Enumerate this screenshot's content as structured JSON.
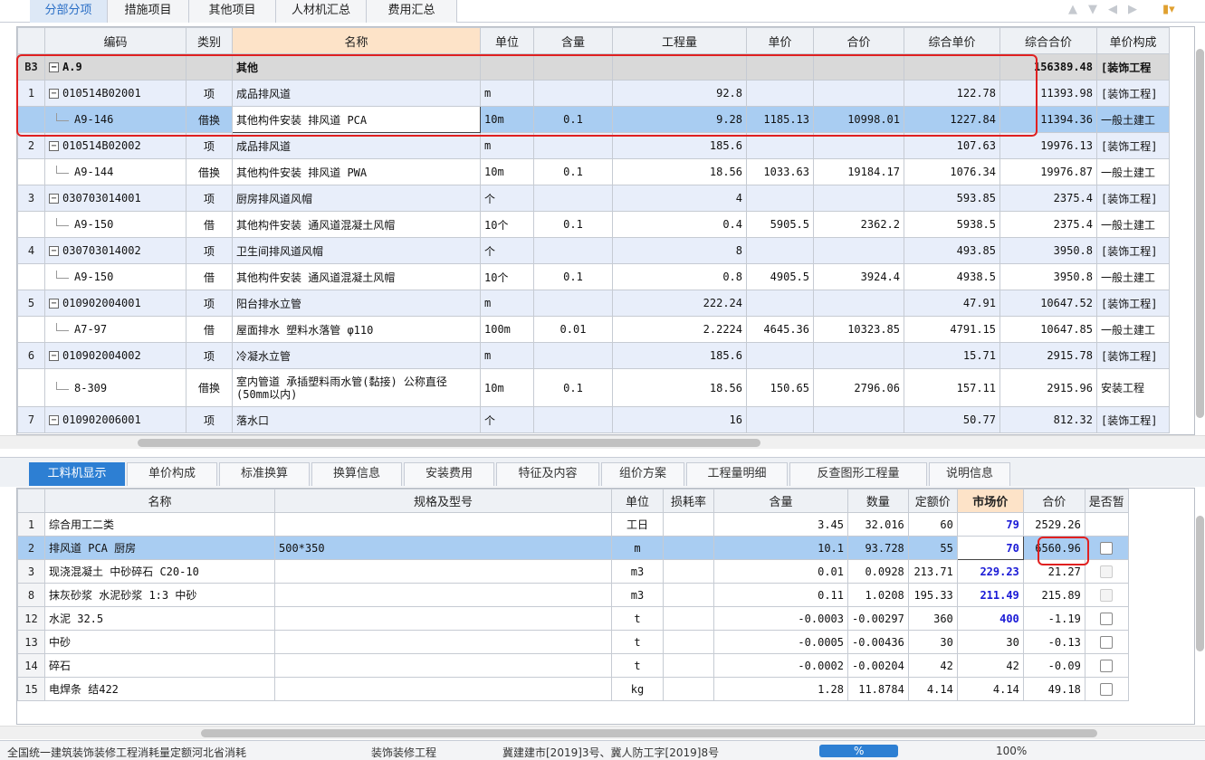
{
  "tabs": [
    "分部分项",
    "措施项目",
    "其他项目",
    "人材机汇总",
    "费用汇总"
  ],
  "top_headers": [
    "",
    "编码",
    "类别",
    "名称",
    "单位",
    "含量",
    "工程量",
    "单价",
    "合价",
    "综合单价",
    "综合合价",
    "单价构成"
  ],
  "top_rows": [
    {
      "kind": "sec",
      "rn": "B3",
      "code": "A.9",
      "cat": "",
      "name": "其他",
      "unit": "",
      "qty_ratio": "",
      "qty": "",
      "price": "",
      "total": "",
      "uprice": "",
      "utotal": "156389.48",
      "comp": "[装饰工程"
    },
    {
      "kind": "item",
      "rn": "1",
      "code": "010514B02001",
      "cat": "项",
      "name": "成品排风道",
      "unit": "m",
      "qty_ratio": "",
      "qty": "92.8",
      "price": "",
      "total": "",
      "uprice": "122.78",
      "utotal": "11393.98",
      "comp": "[装饰工程]"
    },
    {
      "kind": "sel",
      "rn": "",
      "code": "A9-146",
      "cat": "借换",
      "name": "其他构件安装 排风道 PCA",
      "unit": "10m",
      "qty_ratio": "0.1",
      "qty": "9.28",
      "price": "1185.13",
      "total": "10998.01",
      "uprice": "1227.84",
      "utotal": "11394.36",
      "comp": "一般土建工"
    },
    {
      "kind": "item",
      "rn": "2",
      "code": "010514B02002",
      "cat": "项",
      "name": "成品排风道",
      "unit": "m",
      "qty_ratio": "",
      "qty": "185.6",
      "price": "",
      "total": "",
      "uprice": "107.63",
      "utotal": "19976.13",
      "comp": "[装饰工程]"
    },
    {
      "kind": "sub",
      "rn": "",
      "code": "A9-144",
      "cat": "借换",
      "name": "其他构件安装 排风道 PWA",
      "unit": "10m",
      "qty_ratio": "0.1",
      "qty": "18.56",
      "price": "1033.63",
      "total": "19184.17",
      "uprice": "1076.34",
      "utotal": "19976.87",
      "comp": "一般土建工"
    },
    {
      "kind": "item",
      "rn": "3",
      "code": "030703014001",
      "cat": "项",
      "name": "厨房排风道风帽",
      "unit": "个",
      "qty_ratio": "",
      "qty": "4",
      "price": "",
      "total": "",
      "uprice": "593.85",
      "utotal": "2375.4",
      "comp": "[装饰工程]"
    },
    {
      "kind": "sub",
      "rn": "",
      "code": "A9-150",
      "cat": "借",
      "name": "其他构件安装 通风道混凝土风帽",
      "unit": "10个",
      "qty_ratio": "0.1",
      "qty": "0.4",
      "price": "5905.5",
      "total": "2362.2",
      "uprice": "5938.5",
      "utotal": "2375.4",
      "comp": "一般土建工"
    },
    {
      "kind": "item",
      "rn": "4",
      "code": "030703014002",
      "cat": "项",
      "name": "卫生间排风道风帽",
      "unit": "个",
      "qty_ratio": "",
      "qty": "8",
      "price": "",
      "total": "",
      "uprice": "493.85",
      "utotal": "3950.8",
      "comp": "[装饰工程]"
    },
    {
      "kind": "sub",
      "rn": "",
      "code": "A9-150",
      "cat": "借",
      "name": "其他构件安装 通风道混凝土风帽",
      "unit": "10个",
      "qty_ratio": "0.1",
      "qty": "0.8",
      "price": "4905.5",
      "total": "3924.4",
      "uprice": "4938.5",
      "utotal": "3950.8",
      "comp": "一般土建工"
    },
    {
      "kind": "item",
      "rn": "5",
      "code": "010902004001",
      "cat": "项",
      "name": "阳台排水立管",
      "unit": "m",
      "qty_ratio": "",
      "qty": "222.24",
      "price": "",
      "total": "",
      "uprice": "47.91",
      "utotal": "10647.52",
      "comp": "[装饰工程]"
    },
    {
      "kind": "sub",
      "rn": "",
      "code": "A7-97",
      "cat": "借",
      "name": "屋面排水 塑料水落管 φ110",
      "unit": "100m",
      "qty_ratio": "0.01",
      "qty": "2.2224",
      "price": "4645.36",
      "total": "10323.85",
      "uprice": "4791.15",
      "utotal": "10647.85",
      "comp": "一般土建工"
    },
    {
      "kind": "item",
      "rn": "6",
      "code": "010902004002",
      "cat": "项",
      "name": "冷凝水立管",
      "unit": "m",
      "qty_ratio": "",
      "qty": "185.6",
      "price": "",
      "total": "",
      "uprice": "15.71",
      "utotal": "2915.78",
      "comp": "[装饰工程]"
    },
    {
      "kind": "sub tall",
      "rn": "",
      "code": "8-309",
      "cat": "借换",
      "name": "室内管道 承插塑料雨水管(黏接) 公称直径(50mm以内)",
      "unit": "10m",
      "qty_ratio": "0.1",
      "qty": "18.56",
      "price": "150.65",
      "total": "2796.06",
      "uprice": "157.11",
      "utotal": "2915.96",
      "comp": "安装工程"
    },
    {
      "kind": "item",
      "rn": "7",
      "code": "010902006001",
      "cat": "项",
      "name": "落水口",
      "unit": "个",
      "qty_ratio": "",
      "qty": "16",
      "price": "",
      "total": "",
      "uprice": "50.77",
      "utotal": "812.32",
      "comp": "[装饰工程]"
    }
  ],
  "bottom_tabs": [
    "工料机显示",
    "单价构成",
    "标准换算",
    "换算信息",
    "安装费用",
    "特征及内容",
    "组价方案",
    "工程量明细",
    "反查图形工程量",
    "说明信息"
  ],
  "bottom_headers": [
    "",
    "名称",
    "规格及型号",
    "单位",
    "损耗率",
    "含量",
    "数量",
    "定额价",
    "市场价",
    "合价",
    "是否暂"
  ],
  "bottom_rows": [
    {
      "rn": "1",
      "name": "综合用工二类",
      "spec": "",
      "unit": "工日",
      "loss": "",
      "ratio": "3.45",
      "qty": "32.016",
      "base": "60",
      "market": "79",
      "mblue": true,
      "total": "2529.26",
      "chk": "none"
    },
    {
      "rn": "2",
      "name": "排风道 PCA  厨房",
      "spec": "500*350",
      "unit": "m",
      "loss": "",
      "ratio": "10.1",
      "qty": "93.728",
      "base": "55",
      "market": "70",
      "mblue": true,
      "total": "6560.96",
      "chk": "on",
      "sel": true
    },
    {
      "rn": "3",
      "name": "现浇混凝土 中砂碎石 C20-10",
      "spec": "",
      "unit": "m3",
      "loss": "",
      "ratio": "0.01",
      "qty": "0.0928",
      "base": "213.71",
      "market": "229.23",
      "mblue": true,
      "total": "21.27",
      "chk": "dis"
    },
    {
      "rn": "8",
      "name": "抹灰砂浆 水泥砂浆 1:3 中砂",
      "spec": "",
      "unit": "m3",
      "loss": "",
      "ratio": "0.11",
      "qty": "1.0208",
      "base": "195.33",
      "market": "211.49",
      "mblue": true,
      "total": "215.89",
      "chk": "dis"
    },
    {
      "rn": "12",
      "name": "水泥 32.5",
      "spec": "",
      "unit": "t",
      "loss": "",
      "ratio": "-0.0003",
      "qty": "-0.00297",
      "base": "360",
      "market": "400",
      "mblue": true,
      "total": "-1.19",
      "chk": "on"
    },
    {
      "rn": "13",
      "name": "中砂",
      "spec": "",
      "unit": "t",
      "loss": "",
      "ratio": "-0.0005",
      "qty": "-0.00436",
      "base": "30",
      "market": "30",
      "mblue": false,
      "total": "-0.13",
      "chk": "on"
    },
    {
      "rn": "14",
      "name": "碎石",
      "spec": "",
      "unit": "t",
      "loss": "",
      "ratio": "-0.0002",
      "qty": "-0.00204",
      "base": "42",
      "market": "42",
      "mblue": false,
      "total": "-0.09",
      "chk": "on"
    },
    {
      "rn": "15",
      "name": "电焊条 结422",
      "spec": "",
      "unit": "kg",
      "loss": "",
      "ratio": "1.28",
      "qty": "11.8784",
      "base": "4.14",
      "market": "4.14",
      "mblue": false,
      "total": "49.18",
      "chk": "on"
    }
  ],
  "status": [
    "全国统一建筑装饰装修工程消耗量定额河北省消耗",
    "装饰装修工程",
    "冀建建市[2019]3号、冀人防工字[2019]8号",
    "%",
    "100%"
  ]
}
